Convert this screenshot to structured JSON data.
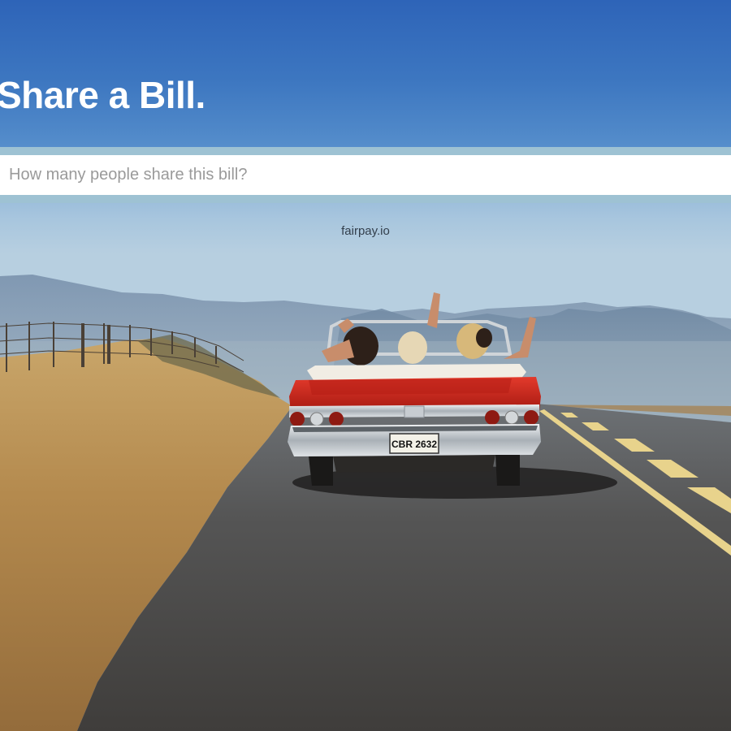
{
  "header": {
    "title": "Share a Bill."
  },
  "people_input": {
    "placeholder": "How many people share this bill?",
    "value": ""
  },
  "brand": {
    "text": "fairpay.io"
  },
  "background": {
    "license_plate": "CBR 2632"
  },
  "colors": {
    "header_blue": "#3a72c0",
    "input_band": "#9ec2d3",
    "car_red": "#c8231c",
    "road": "#4a4846",
    "sand": "#b48a4e"
  }
}
